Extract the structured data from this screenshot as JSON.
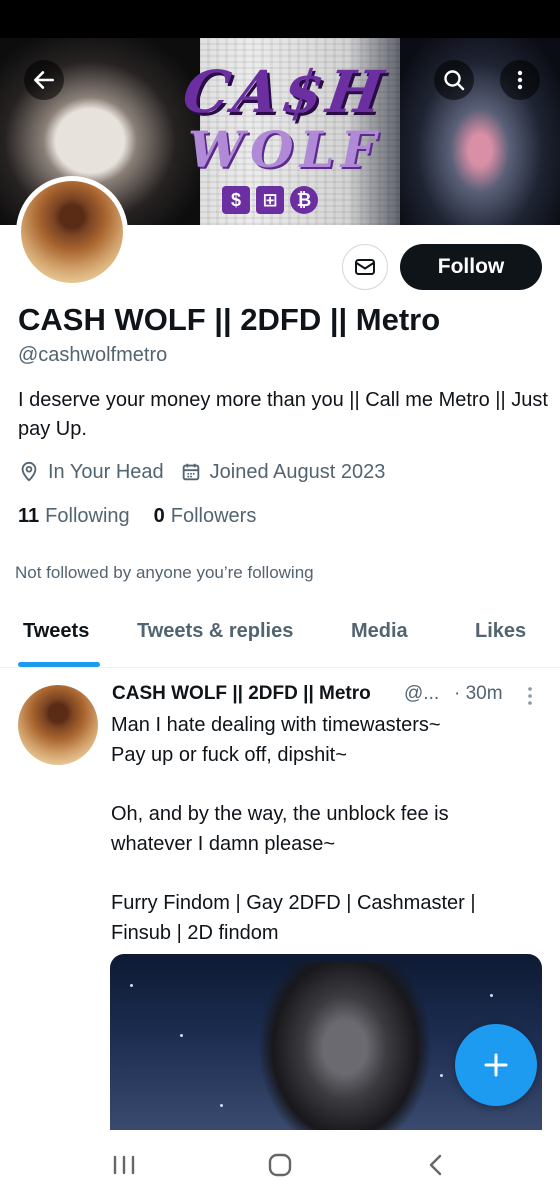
{
  "banner": {
    "title": "CA$H",
    "subtitle": "WOLF",
    "badges": [
      "$",
      "⊞",
      "₿"
    ]
  },
  "header_actions": {
    "back_icon": "arrow-left-icon",
    "search_icon": "search-icon",
    "more_icon": "more-vertical-icon"
  },
  "profile": {
    "follow_label": "Follow",
    "message_icon": "mail-icon",
    "display_name": "CASH WOLF || 2DFD || Metro",
    "handle": "@cashwolfmetro",
    "bio": "I deserve your money more than you || Call me Metro || Just pay Up.",
    "location": "In Your Head",
    "joined": "Joined August 2023",
    "following_count": "11",
    "following_label": "Following",
    "followers_count": "0",
    "followers_label": "Followers",
    "not_followed_note": "Not followed by anyone you’re following"
  },
  "tabs": [
    {
      "label": "Tweets",
      "active": true
    },
    {
      "label": "Tweets & replies",
      "active": false
    },
    {
      "label": "Media",
      "active": false
    },
    {
      "label": "Likes",
      "active": false
    }
  ],
  "tweet": {
    "name": "CASH WOLF || 2DFD || Metro",
    "handle": "@...",
    "time": "· 30m",
    "lines": [
      "Man I hate dealing with timewasters~",
      "Pay up or fuck off, dipshit~",
      "",
      "Oh, and by the way, the unblock fee is",
      "whatever I damn please~",
      "",
      "Furry Findom | Gay 2DFD | Cashmaster |",
      "Finsub | 2D findom"
    ]
  },
  "fab_icon": "plus-icon",
  "accent_color": "#1d9bf0",
  "nav_bar": [
    "recents-icon",
    "home-icon",
    "back-icon"
  ]
}
